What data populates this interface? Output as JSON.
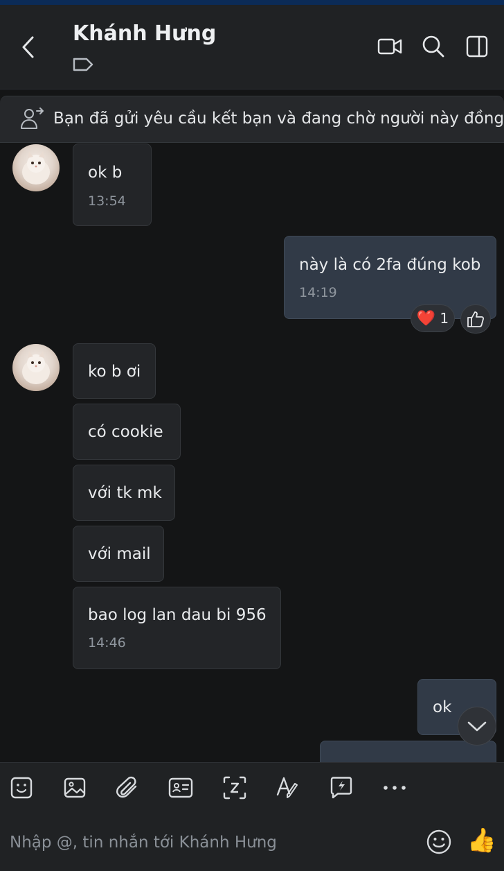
{
  "header": {
    "contact_name": "Khánh Hưng",
    "icons": [
      "back-icon",
      "tag-icon",
      "video-call-icon",
      "search-icon",
      "side-panel-icon"
    ]
  },
  "banner": {
    "text": "Bạn đã gửi yêu cầu kết bạn và đang chờ người này đồng ý",
    "icon": "friend-request-icon"
  },
  "messages": [
    {
      "sender": "them",
      "text": "ok b",
      "time": "13:54"
    },
    {
      "sender": "me",
      "text": "này là có 2fa đúng kob",
      "time": "14:19",
      "reaction": {
        "emoji": "❤️",
        "count": "1"
      }
    },
    {
      "sender": "them",
      "text": "ko b ơi"
    },
    {
      "sender": "them",
      "text": "có cookie"
    },
    {
      "sender": "them",
      "text": "với tk mk"
    },
    {
      "sender": "them",
      "text": "với mail"
    },
    {
      "sender": "them",
      "text": "bao log lan dau bi 956",
      "time": "14:46"
    },
    {
      "sender": "me",
      "text": "ok"
    }
  ],
  "toolbar": {
    "icons": [
      "sticker-icon",
      "image-icon",
      "attachment-icon",
      "contact-card-icon",
      "screenshot-icon",
      "text-format-icon",
      "quick-message-icon",
      "more-icon"
    ]
  },
  "composer": {
    "placeholder": "Nhập @, tin nhắn tới Khánh Hưng",
    "like_emoji": "👍"
  },
  "colors": {
    "background": "#141516",
    "header": "#202224",
    "bubble_them": "#232528",
    "bubble_me": "#313a47"
  }
}
